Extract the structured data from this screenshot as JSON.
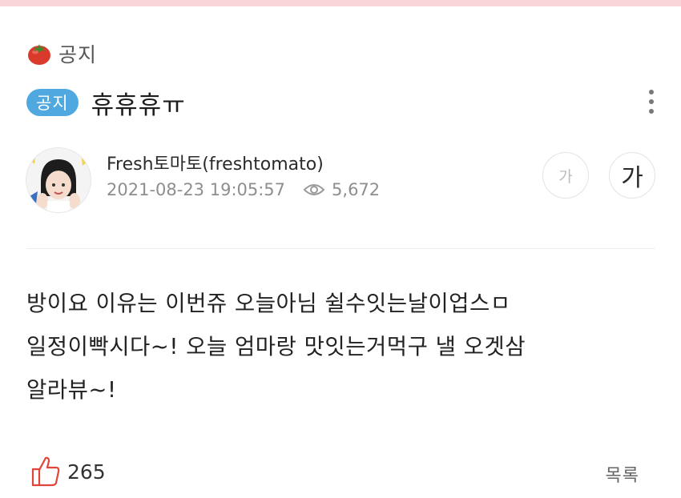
{
  "category": {
    "icon": "tomato-icon",
    "label": "공지"
  },
  "post": {
    "badge": "공지",
    "title": "휴휴휴ㅠ",
    "author": "Fresh토마토(freshtomato)",
    "datetime": "2021-08-23 19:05:57",
    "views": "5,672",
    "body_lines": [
      "방이요 이유는 이번쥬 오늘아님 쉴수잇는날이업스ㅁ",
      "일정이빡시다~! 오늘 엄마랑 맛잇는거먹구 낼 오겟삼",
      "알라뷰~!"
    ],
    "likes": "265"
  },
  "font_controls": {
    "small": "가",
    "large": "가"
  },
  "footer": {
    "list_label": "목록"
  },
  "colors": {
    "badge": "#4fa8e0",
    "top_bar": "#f9d5d8",
    "like_icon": "#e0453a"
  },
  "icons": {
    "more": "more-vertical-icon",
    "views": "eye-icon",
    "like": "thumbs-up-icon"
  }
}
